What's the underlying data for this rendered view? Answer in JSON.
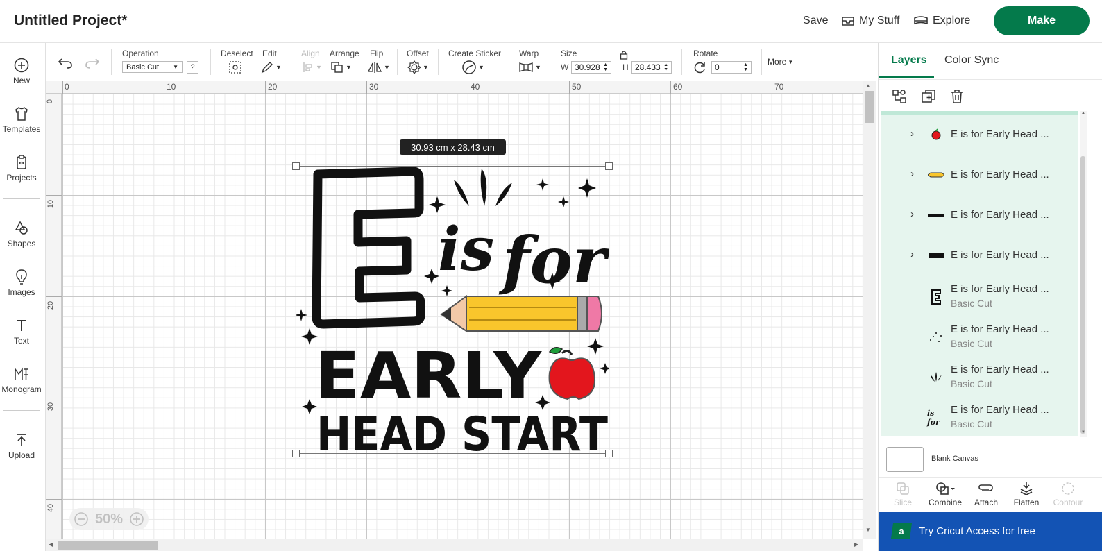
{
  "header": {
    "title": "Untitled Project*",
    "save_label": "Save",
    "mystuff_label": "My Stuff",
    "explore_label": "Explore",
    "make_label": "Make"
  },
  "sidebar": {
    "items": [
      {
        "label": "New",
        "icon": "plus-circle-icon"
      },
      {
        "label": "Templates",
        "icon": "tshirt-icon"
      },
      {
        "label": "Projects",
        "icon": "clipboard-icon"
      },
      {
        "label": "Shapes",
        "icon": "shapes-icon"
      },
      {
        "label": "Images",
        "icon": "lightbulb-icon"
      },
      {
        "label": "Text",
        "icon": "text-icon"
      },
      {
        "label": "Monogram",
        "icon": "monogram-icon"
      },
      {
        "label": "Upload",
        "icon": "upload-icon"
      }
    ]
  },
  "toolbar": {
    "operation_label": "Operation",
    "operation_value": "Basic Cut",
    "help_label": "?",
    "deselect_label": "Deselect",
    "edit_label": "Edit",
    "align_label": "Align",
    "arrange_label": "Arrange",
    "flip_label": "Flip",
    "offset_label": "Offset",
    "sticker_label": "Create Sticker",
    "warp_label": "Warp",
    "size_label": "Size",
    "w_label": "W",
    "w_value": "30.928",
    "h_label": "H",
    "h_value": "28.433",
    "rotate_label": "Rotate",
    "rotate_value": "0",
    "more_label": "More"
  },
  "ruler": {
    "top_ticks": [
      "0",
      "10",
      "20",
      "30",
      "40",
      "50",
      "60",
      "70"
    ],
    "left_ticks": [
      "0",
      "10",
      "20",
      "30",
      "40"
    ]
  },
  "canvas": {
    "size_tooltip": "30.93  cm x 28.43  cm",
    "zoom_label": "50%",
    "design": {
      "word_is": "is",
      "word_for": "for",
      "word_early": "EARLY",
      "word_headstart": "HEAD START",
      "colors": {
        "pencil": "#f9c62c",
        "eraser": "#ef79a6",
        "apple": "#e3161d",
        "leaf": "#1e9d3a",
        "ink": "#111111"
      }
    }
  },
  "panel": {
    "tab_layers": "Layers",
    "tab_colorsync": "Color Sync",
    "layers": [
      {
        "name": "E is for Early Head ...",
        "sub": "",
        "group": true,
        "thumb": "apple-icon"
      },
      {
        "name": "E is for Early Head ...",
        "sub": "",
        "group": true,
        "thumb": "pencil-icon"
      },
      {
        "name": "E is for Early Head ...",
        "sub": "",
        "group": true,
        "thumb": "head-start-text-icon"
      },
      {
        "name": "E is for Early Head ...",
        "sub": "",
        "group": true,
        "thumb": "early-text-icon"
      },
      {
        "name": "E is for Early Head ...",
        "sub": "Basic Cut",
        "group": false,
        "thumb": "letter-e-icon"
      },
      {
        "name": "E is for Early Head ...",
        "sub": "Basic Cut",
        "group": false,
        "thumb": "sparkles-icon"
      },
      {
        "name": "E is for Early Head ...",
        "sub": "Basic Cut",
        "group": false,
        "thumb": "burst-icon"
      },
      {
        "name": "E is for Early Head ...",
        "sub": "Basic Cut",
        "group": false,
        "thumb": "is-for-text-icon"
      }
    ],
    "blank_canvas_label": "Blank Canvas",
    "actions": {
      "slice": "Slice",
      "combine": "Combine",
      "attach": "Attach",
      "flatten": "Flatten",
      "contour": "Contour"
    },
    "access_banner": "Try Cricut Access for free",
    "access_icon_letter": "a",
    "accent_color": "#047a4b",
    "banner_color": "#1353b4"
  }
}
